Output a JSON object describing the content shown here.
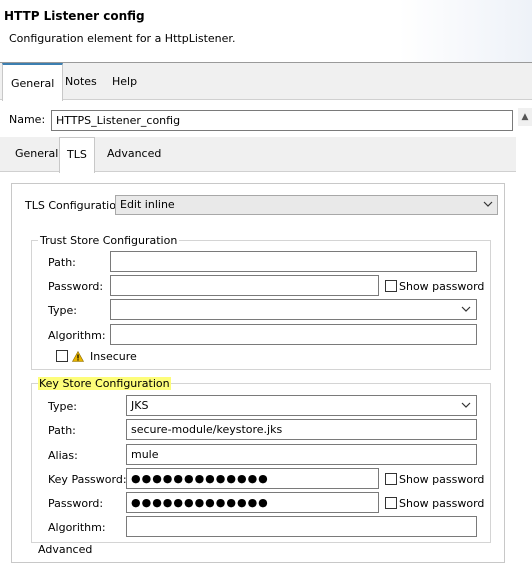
{
  "header": {
    "title": "HTTP Listener config",
    "description": "Configuration element for a HttpListener."
  },
  "top_tabs": [
    {
      "label": "General"
    },
    {
      "label": "Notes"
    },
    {
      "label": "Help"
    }
  ],
  "name_field": {
    "label": "Name:",
    "value": "HTTPS_Listener_config"
  },
  "sub_tabs": [
    {
      "label": "General"
    },
    {
      "label": "TLS"
    },
    {
      "label": "Advanced"
    }
  ],
  "tls": {
    "label": "TLS Configuration",
    "selected": "Edit inline"
  },
  "trust_store": {
    "title": "Trust Store Configuration",
    "path_label": "Path:",
    "path_value": "",
    "password_label": "Password:",
    "password_value": "",
    "show_password_label": "Show password",
    "type_label": "Type:",
    "type_value": "",
    "algorithm_label": "Algorithm:",
    "algorithm_value": "",
    "insecure_label": "Insecure"
  },
  "key_store": {
    "title": "Key Store Configuration",
    "type_label": "Type:",
    "type_value": "JKS",
    "path_label": "Path:",
    "path_value": "secure-module/keystore.jks",
    "alias_label": "Alias:",
    "alias_value": "mule",
    "key_password_label": "Key Password:",
    "key_password_value": "●●●●●●●●●●●●●",
    "password_label": "Password:",
    "password_value": "●●●●●●●●●●●●●",
    "show_password_label": "Show password",
    "algorithm_label": "Algorithm:",
    "algorithm_value": ""
  },
  "cutoff_label": "Advanced",
  "colors": {
    "highlight": "#fdfd7a",
    "tab_accent": "#3c7fb1",
    "warning": "#e8b400"
  }
}
